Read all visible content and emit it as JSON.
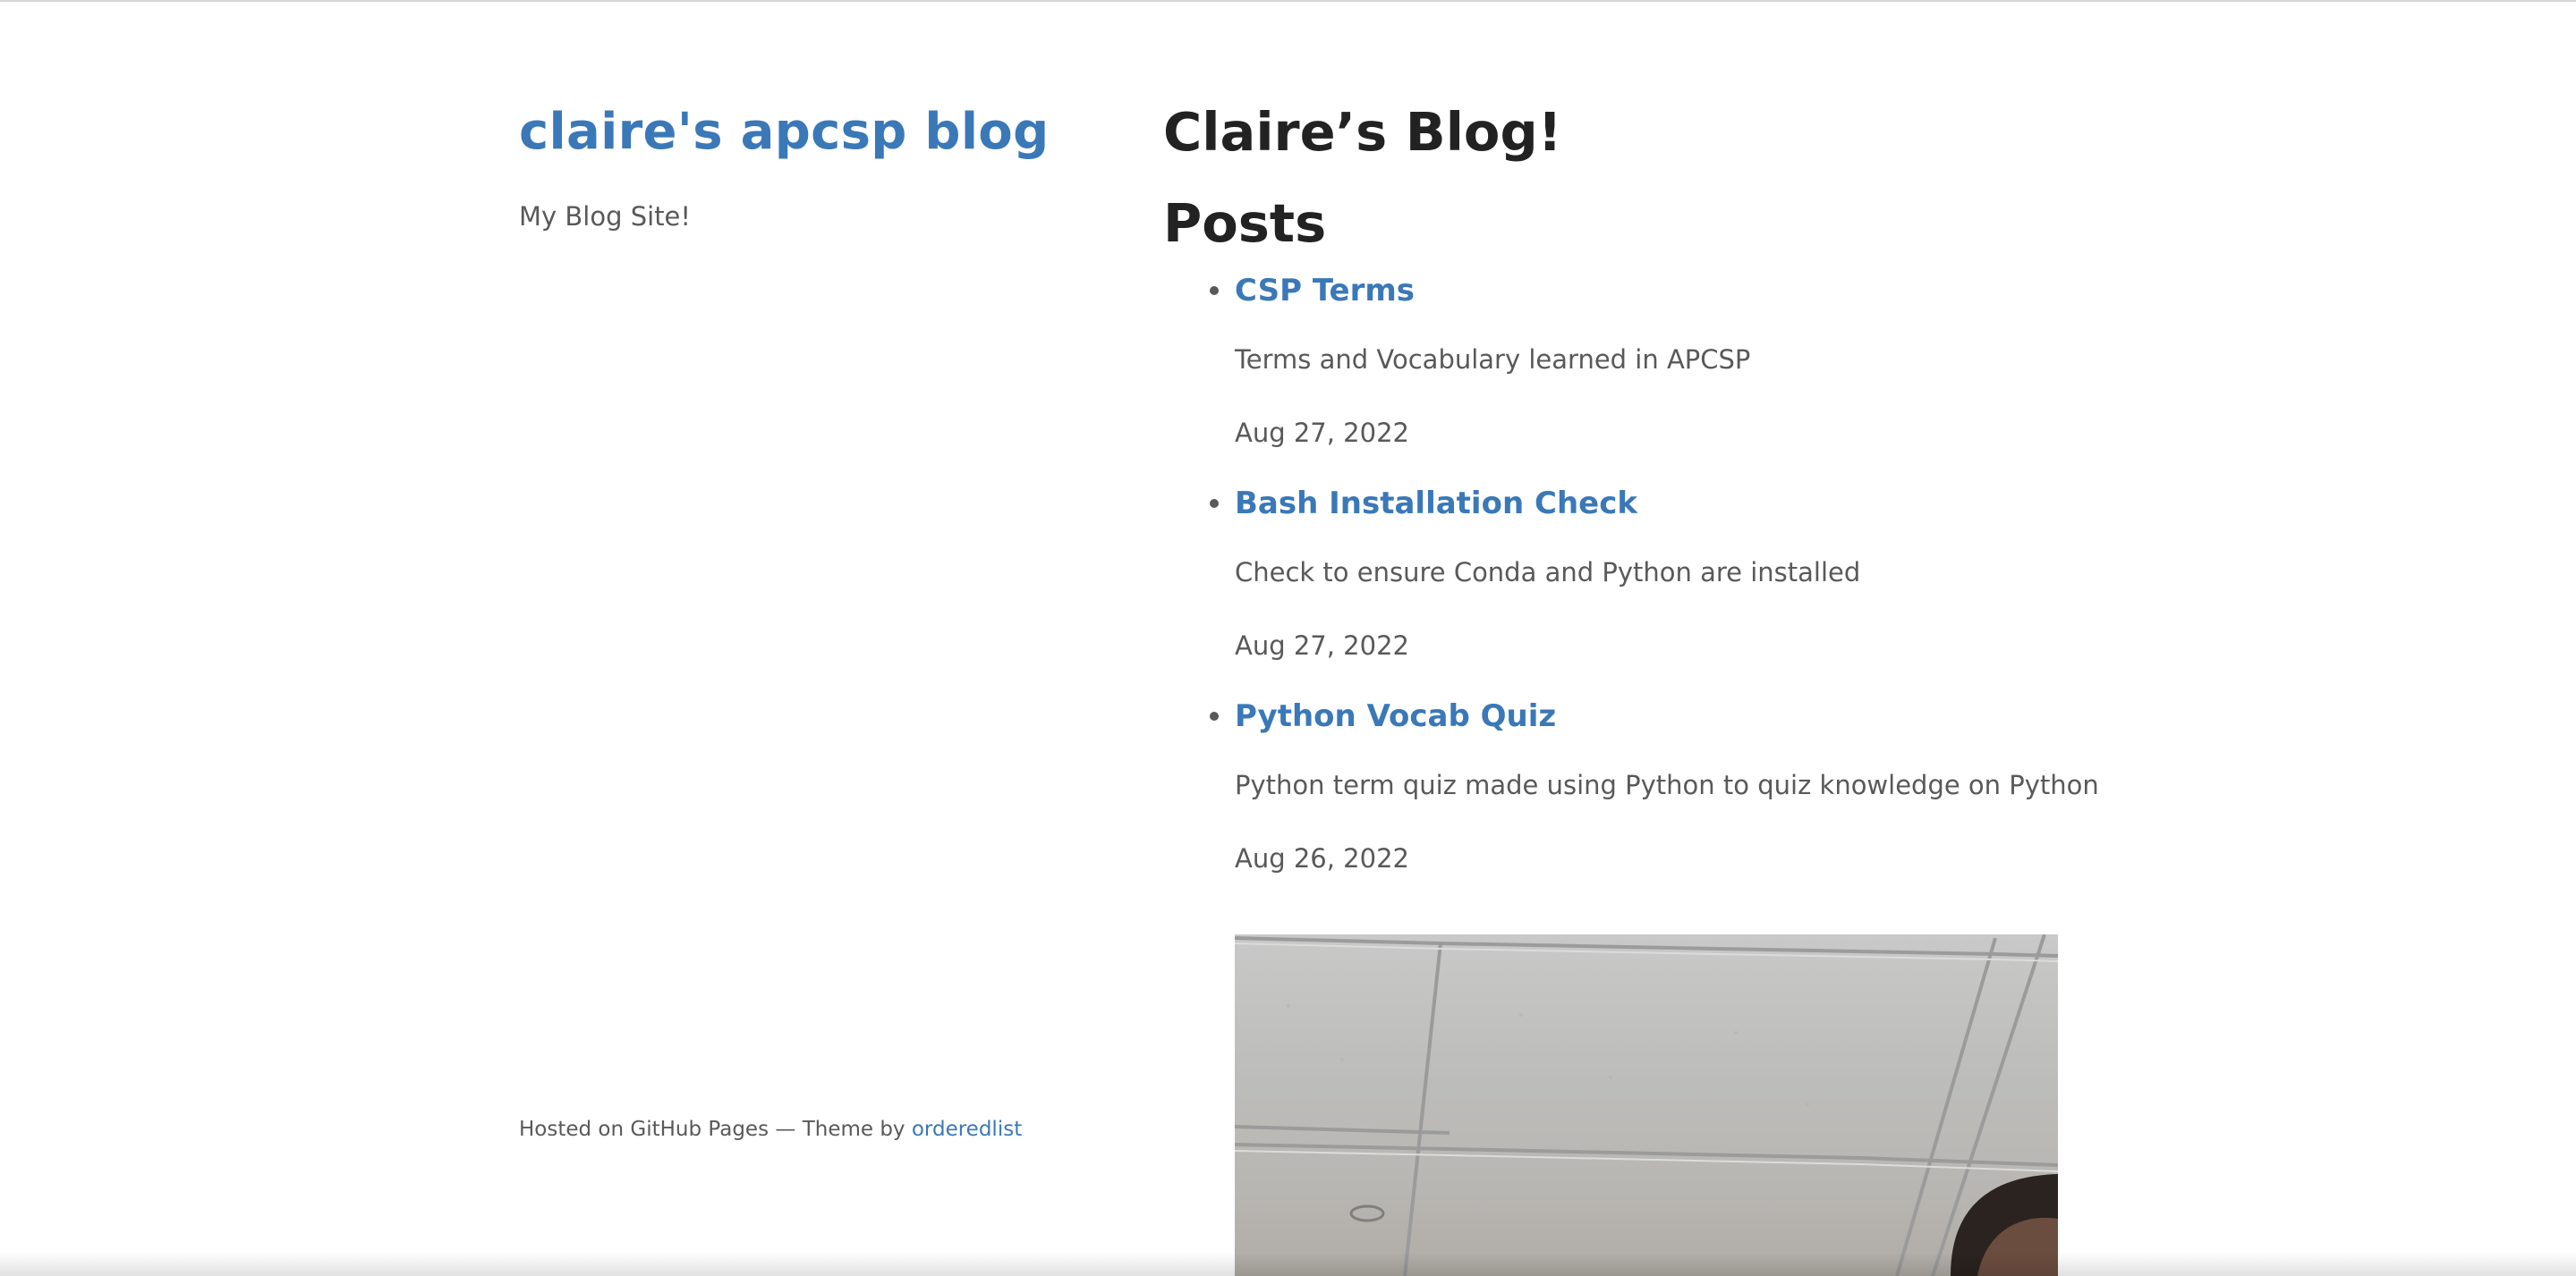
{
  "sidebar": {
    "site_title": "claire's apcsp blog",
    "description": "My Blog Site!",
    "footer": {
      "text": "Hosted on GitHub Pages — Theme by ",
      "link_label": "orderedlist"
    }
  },
  "main": {
    "blog_title": "Claire’s Blog!",
    "posts_heading": "Posts",
    "posts": [
      {
        "title": "CSP Terms",
        "description": "Terms and Vocabulary learned in APCSP",
        "date": "Aug 27, 2022"
      },
      {
        "title": "Bash Installation Check",
        "description": "Check to ensure Conda and Python are installed",
        "date": "Aug 27, 2022"
      },
      {
        "title": "Python Vocab Quiz",
        "description": "Python term quiz made using Python to quiz knowledge on Python",
        "date": "Aug 26, 2022"
      }
    ]
  },
  "colors": {
    "link": "#3a78b8",
    "heading": "#222222",
    "text": "#595959",
    "background": "#ffffff"
  }
}
